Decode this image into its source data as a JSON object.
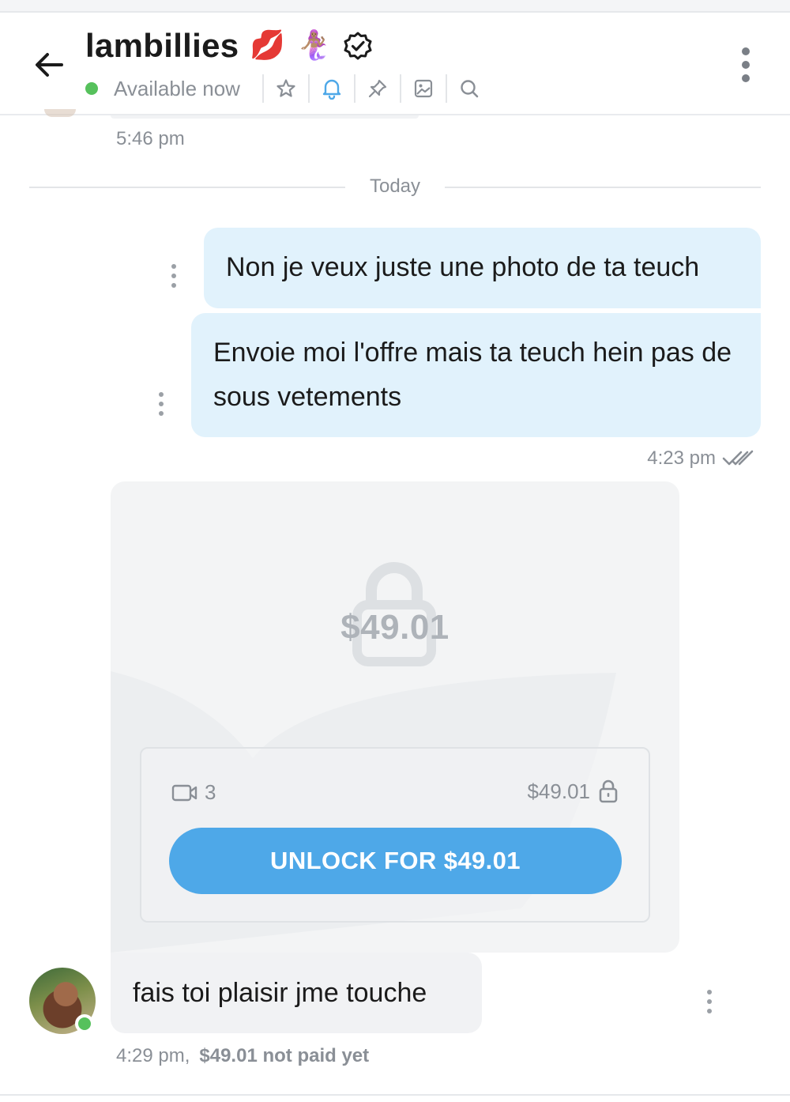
{
  "header": {
    "name": "lambillies",
    "emojis": [
      "💋",
      "🧜🏽‍♀️"
    ],
    "status": "Available now"
  },
  "previous_message": {
    "time": "5:46 pm"
  },
  "divider": {
    "label": "Today"
  },
  "outgoing": [
    {
      "text": "Non je veux juste une photo de ta teuch"
    },
    {
      "text": "Envoie moi l'offre mais ta teuch hein pas de sous vetements"
    }
  ],
  "outgoing_time": "4:23 pm",
  "locked_message": {
    "price_overlay": "$49.01",
    "media_count": "3",
    "price": "$49.01",
    "unlock_label": "UNLOCK FOR $49.01"
  },
  "incoming": {
    "text": "fais toi plaisir jme touche",
    "time": "4:29 pm,",
    "payment_status": "$49.01 not paid yet"
  },
  "colors": {
    "accent": "#4ea8e8",
    "online": "#56c15c",
    "outgoing_bubble": "#e1f2fc",
    "incoming_bubble": "#f1f2f4"
  },
  "icons": [
    "back-arrow-icon",
    "verified-icon",
    "star-icon",
    "bell-icon",
    "pin-icon",
    "image-icon",
    "search-icon",
    "more-vertical-icon",
    "double-check-icon",
    "lock-icon",
    "video-icon"
  ]
}
